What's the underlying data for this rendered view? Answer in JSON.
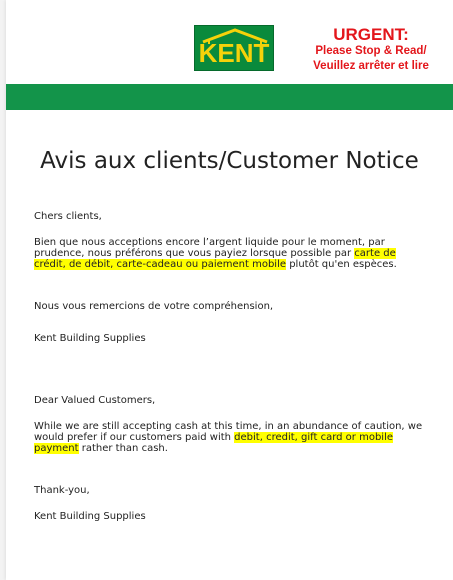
{
  "header": {
    "logo_text": "KENT",
    "urgent_title": "URGENT:",
    "urgent_line1": "Please Stop & Read/",
    "urgent_line2": "Veuillez arrêter et lire"
  },
  "notice": {
    "title": "Avis aux clients/Customer Notice"
  },
  "french": {
    "greeting": "Chers clients,",
    "p1_line1": "Bien que nous acceptions encore l’argent liquide pour le moment, par",
    "p1_line2_a": "prudence, nous préférons que vous payiez lorsque possible par ",
    "p1_line2_hl": "carte de",
    "p1_line3_hl": "crédit, de débit, carte-cadeau ou paiement mobile",
    "p1_line3_b": " plutôt qu'en espèces.",
    "thanks": "Nous vous remercions de votre compréhension,",
    "signature": "Kent Building Supplies"
  },
  "english": {
    "greeting": "Dear Valued Customers,",
    "p1_line1": "While we are still accepting cash at this time, in an abundance of caution, we",
    "p1_line2_a": "would prefer if our customers paid with ",
    "p1_line2_hl": "debit, credit, gift card or mobile",
    "p1_line3_hl": "payment",
    "p1_line3_b": " rather than cash.",
    "thanks": "Thank-you,",
    "signature": "Kent Building Supplies"
  }
}
